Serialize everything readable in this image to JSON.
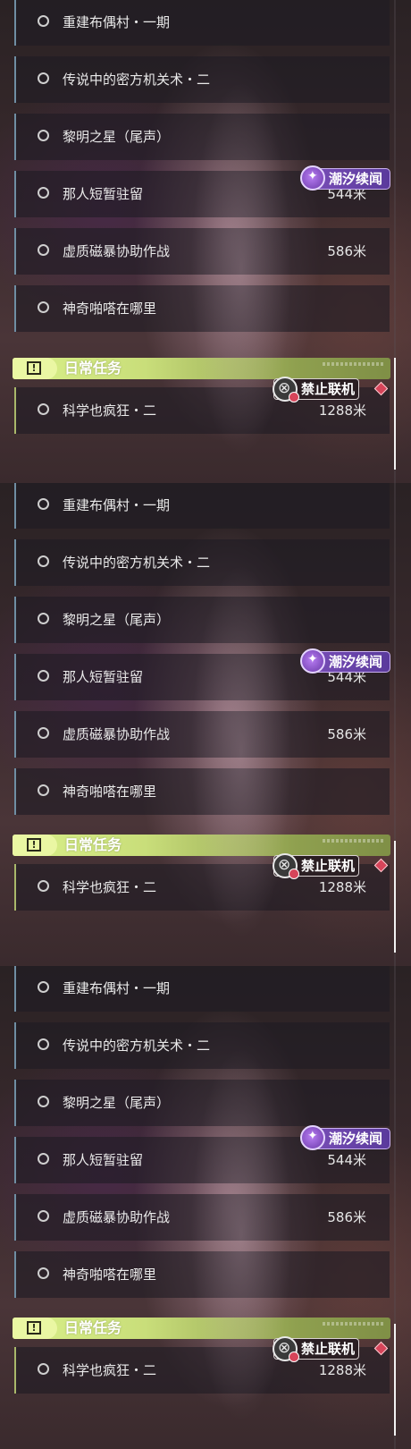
{
  "panels": [
    {
      "rows": [
        {
          "title": "重建布偶村・一期",
          "distance": ""
        },
        {
          "title": "传说中的密方机关术・二",
          "distance": ""
        },
        {
          "title": "黎明之星（尾声）",
          "distance": ""
        },
        {
          "title": "那人短暂驻留",
          "distance": "544米"
        },
        {
          "title": "虚质磁暴协助作战",
          "distance": "586米"
        },
        {
          "title": "神奇啪嗒在哪里",
          "distance": ""
        }
      ],
      "chaoxi_badge": "潮汐续闻",
      "daily": {
        "header": "日常任务",
        "badge": "禁止联机",
        "title": "科学也疯狂・二",
        "distance": "1288米"
      }
    },
    {
      "rows": [
        {
          "title": "重建布偶村・一期",
          "distance": ""
        },
        {
          "title": "传说中的密方机关术・二",
          "distance": ""
        },
        {
          "title": "黎明之星（尾声）",
          "distance": ""
        },
        {
          "title": "那人短暂驻留",
          "distance": "544米"
        },
        {
          "title": "虚质磁暴协助作战",
          "distance": "586米"
        },
        {
          "title": "神奇啪嗒在哪里",
          "distance": ""
        }
      ],
      "chaoxi_badge": "潮汐续闻",
      "daily": {
        "header": "日常任务",
        "badge": "禁止联机",
        "title": "科学也疯狂・二",
        "distance": "1288米"
      }
    },
    {
      "rows": [
        {
          "title": "重建布偶村・一期",
          "distance": ""
        },
        {
          "title": "传说中的密方机关术・二",
          "distance": ""
        },
        {
          "title": "黎明之星（尾声）",
          "distance": ""
        },
        {
          "title": "那人短暂驻留",
          "distance": "544米"
        },
        {
          "title": "虚质磁暴协助作战",
          "distance": "586米"
        },
        {
          "title": "神奇啪嗒在哪里",
          "distance": ""
        }
      ],
      "chaoxi_badge": "潮汐续闻",
      "daily": {
        "header": "日常任务",
        "badge": "禁止联机",
        "title": "科学也疯狂・二",
        "distance": "1288米"
      }
    }
  ]
}
